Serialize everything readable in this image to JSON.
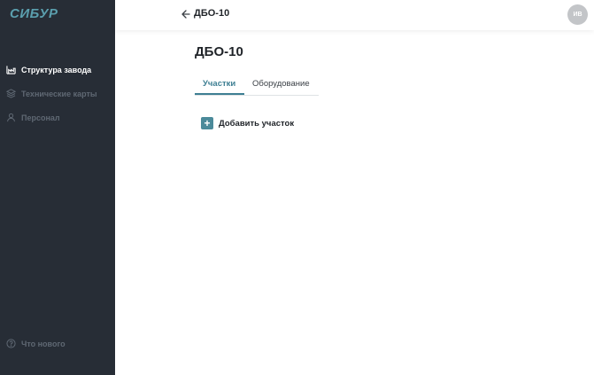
{
  "sidebar": {
    "logo": "СИБУР",
    "items": [
      {
        "label": "Структура завода",
        "icon": "factory-icon",
        "active": true
      },
      {
        "label": "Технические карты",
        "icon": "layers-icon",
        "active": false
      },
      {
        "label": "Персонал",
        "icon": "user-icon",
        "active": false
      }
    ],
    "whats_new": {
      "label": "Что нового",
      "icon": "help-circle-icon"
    }
  },
  "header": {
    "title": "ДБО-10",
    "back_icon": "arrow-left-icon",
    "avatar_initials": "ИВ"
  },
  "main": {
    "title": "ДБО-10",
    "tabs": [
      {
        "label": "Участки",
        "active": true
      },
      {
        "label": "Оборудование",
        "active": false
      }
    ],
    "add_button": {
      "label": "Добавить участок",
      "icon": "plus-icon"
    }
  },
  "colors": {
    "sidebar_bg": "#272d36",
    "accent": "#3e7f93",
    "logo": "#5b9fae"
  }
}
